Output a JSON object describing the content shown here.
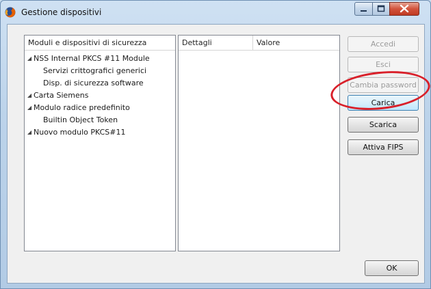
{
  "window": {
    "title": "Gestione dispositivi"
  },
  "modules_panel": {
    "header": "Moduli e dispositivi di sicurezza",
    "items": [
      {
        "label": "NSS Internal PKCS #11 Module",
        "level": 0,
        "expanded": true
      },
      {
        "label": "Servizi crittografici generici",
        "level": 1
      },
      {
        "label": "Disp. di sicurezza software",
        "level": 1
      },
      {
        "label": "Carta Siemens",
        "level": 0,
        "expanded": true
      },
      {
        "label": "Modulo radice predefinito",
        "level": 0,
        "expanded": true
      },
      {
        "label": "Builtin Object Token",
        "level": 1
      },
      {
        "label": "Nuovo modulo PKCS#11",
        "level": 0,
        "expanded": true
      }
    ]
  },
  "details_panel": {
    "col_details": "Dettagli",
    "col_value": "Valore"
  },
  "buttons": {
    "accedi": "Accedi",
    "esci": "Esci",
    "cambia_password": "Cambia password",
    "carica": "Carica",
    "scarica": "Scarica",
    "attiva_fips": "Attiva FIPS",
    "ok": "OK"
  },
  "colors": {
    "annotation": "#d9202a",
    "title_bar": "#c4d8ed",
    "close_button": "#c9452e"
  }
}
